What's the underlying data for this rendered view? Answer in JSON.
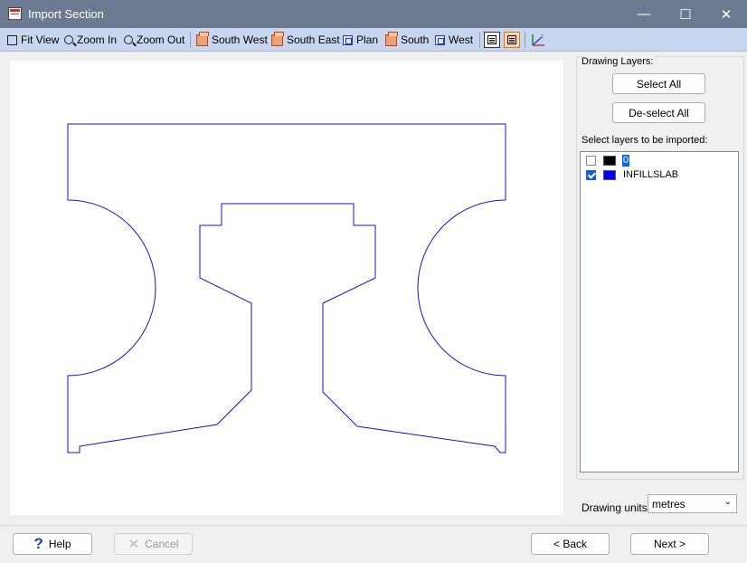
{
  "window": {
    "title": "Import Section",
    "controls": {
      "minimize": "—",
      "maximize": "☐",
      "close": "✕"
    }
  },
  "toolbar": {
    "items": [
      {
        "id": "fit",
        "label": "Fit View",
        "icon": "fit-view-icon"
      },
      {
        "id": "zoom_in",
        "label": "Zoom In",
        "icon": "zoom-in-icon"
      },
      {
        "id": "zoom_out",
        "label": "Zoom Out",
        "icon": "zoom-out-icon"
      },
      {
        "id": "south_west",
        "label": "South West",
        "icon": "south-west-view-icon"
      },
      {
        "id": "south_east",
        "label": "South East",
        "icon": "south-east-view-icon"
      },
      {
        "id": "plan",
        "label": "Plan",
        "icon": "plan-view-icon"
      },
      {
        "id": "south",
        "label": "South",
        "icon": "south-view-icon"
      },
      {
        "id": "west",
        "label": "West",
        "icon": "west-view-icon"
      }
    ],
    "toggles": [
      {
        "id": "list-view",
        "icon": "list-view-icon",
        "active": false
      },
      {
        "id": "detail-view",
        "icon": "detail-view-icon",
        "active": true
      }
    ],
    "axes_icon": "axes-icon"
  },
  "drawing": {
    "stroke_color": "#1515c8",
    "background": "#ffffff"
  },
  "layers_panel": {
    "group_label": "Drawing Layers:",
    "select_all": "Select All",
    "deselect_all": "De-select All",
    "list_label": "Select layers to be imported:",
    "layers": [
      {
        "name": "0",
        "checked": false,
        "color": "#000000",
        "selected": true
      },
      {
        "name": "INFILLSLAB",
        "checked": true,
        "color": "#0000ff",
        "selected": false
      }
    ]
  },
  "units": {
    "label": "Drawing units:",
    "value": "metres"
  },
  "footer": {
    "help": "Help",
    "cancel": "Cancel",
    "back": "< Back",
    "next": "Next >"
  }
}
